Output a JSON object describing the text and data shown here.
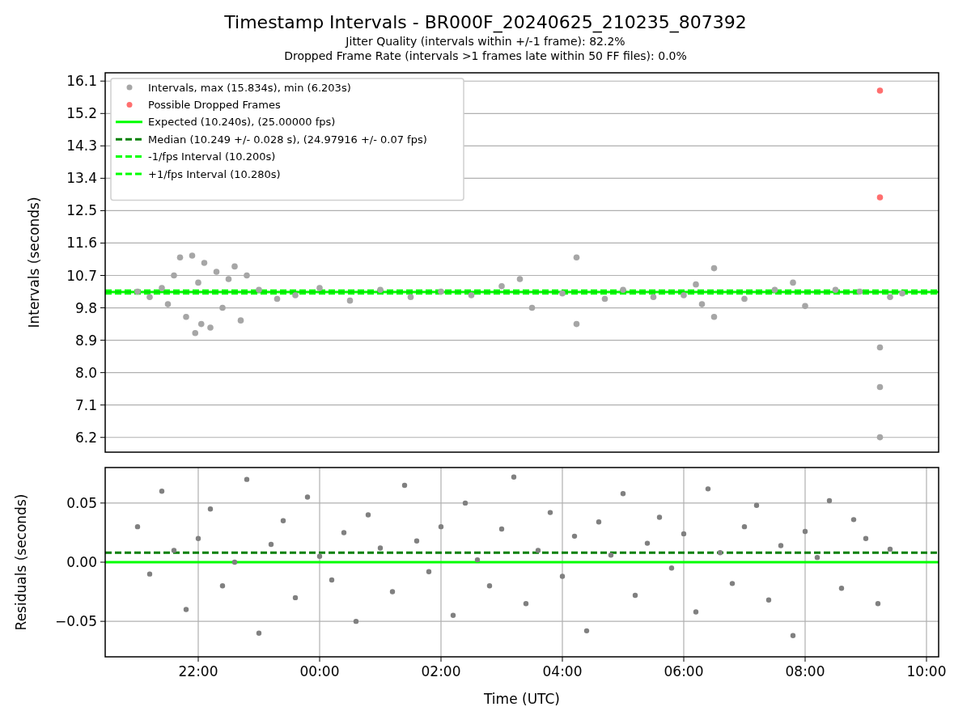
{
  "figure": {
    "title": "Timestamp Intervals - BR000F_20240625_210235_807392",
    "subtitles": [
      "Jitter Quality (intervals within +/-1 frame): 82.2%",
      "Dropped Frame Rate (intervals >1 frames late within 50 FF files): 0.0%"
    ]
  },
  "intervals_plot": {
    "chart_data": {
      "type": "scatter",
      "ylabel": "Intervals (seconds)",
      "grid": true,
      "legend": true,
      "xlim": [
        "2024-06-25T20:28",
        "2024-06-26T10:12"
      ],
      "ylim": [
        5.79,
        16.33
      ],
      "yticks": [
        {
          "value": 6.2,
          "label": "6.2"
        },
        {
          "value": 7.1,
          "label": "7.1"
        },
        {
          "value": 8.0,
          "label": "8.0"
        },
        {
          "value": 8.9,
          "label": "8.9"
        },
        {
          "value": 9.8,
          "label": "9.8"
        },
        {
          "value": 10.7,
          "label": "10.7"
        },
        {
          "value": 11.6,
          "label": "11.6"
        },
        {
          "value": 12.5,
          "label": "12.5"
        },
        {
          "value": 13.4,
          "label": "13.4"
        },
        {
          "value": 14.3,
          "label": "14.3"
        },
        {
          "value": 15.2,
          "label": "15.2"
        },
        {
          "value": 16.1,
          "label": "16.1"
        }
      ],
      "series": [
        {
          "name": "Intervals, max (15.834s), min (6.203s)",
          "color": "#a6a6a6",
          "x": [
            "2024-06-25T21:00",
            "2024-06-25T21:12",
            "2024-06-25T21:24",
            "2024-06-25T21:30",
            "2024-06-25T21:36",
            "2024-06-25T21:42",
            "2024-06-25T21:48",
            "2024-06-25T21:54",
            "2024-06-25T21:57",
            "2024-06-25T22:00",
            "2024-06-25T22:03",
            "2024-06-25T22:06",
            "2024-06-25T22:12",
            "2024-06-25T22:18",
            "2024-06-25T22:24",
            "2024-06-25T22:30",
            "2024-06-25T22:36",
            "2024-06-25T22:42",
            "2024-06-25T22:48",
            "2024-06-25T23:00",
            "2024-06-25T23:18",
            "2024-06-25T23:36",
            "2024-06-26T00:00",
            "2024-06-26T00:30",
            "2024-06-26T01:00",
            "2024-06-26T01:30",
            "2024-06-26T02:00",
            "2024-06-26T02:30",
            "2024-06-26T03:00",
            "2024-06-26T03:18",
            "2024-06-26T03:30",
            "2024-06-26T04:00",
            "2024-06-26T04:14",
            "2024-06-26T04:14",
            "2024-06-26T04:42",
            "2024-06-26T05:00",
            "2024-06-26T05:30",
            "2024-06-26T06:00",
            "2024-06-26T06:12",
            "2024-06-26T06:18",
            "2024-06-26T06:30",
            "2024-06-26T06:30",
            "2024-06-26T07:00",
            "2024-06-26T07:30",
            "2024-06-26T07:48",
            "2024-06-26T08:00",
            "2024-06-26T08:30",
            "2024-06-26T08:54",
            "2024-06-26T09:14",
            "2024-06-26T09:14",
            "2024-06-26T09:14",
            "2024-06-26T09:24",
            "2024-06-26T09:36"
          ],
          "values": [
            10.25,
            10.1,
            10.35,
            9.9,
            10.7,
            11.2,
            9.55,
            11.25,
            9.1,
            10.5,
            9.35,
            11.05,
            9.25,
            10.8,
            9.8,
            10.6,
            10.95,
            9.45,
            10.7,
            10.3,
            10.05,
            10.15,
            10.35,
            10.0,
            10.3,
            10.1,
            10.25,
            10.15,
            10.4,
            10.6,
            9.8,
            10.2,
            11.2,
            9.35,
            10.05,
            10.3,
            10.1,
            10.15,
            10.45,
            9.9,
            10.9,
            9.55,
            10.05,
            10.3,
            10.5,
            9.85,
            10.3,
            10.25,
            8.7,
            7.6,
            6.203,
            10.1,
            10.2
          ]
        },
        {
          "name": "Possible Dropped Frames",
          "color": "#ff6f6f",
          "x": [
            "2024-06-26T09:14",
            "2024-06-26T09:14"
          ],
          "values": [
            15.834,
            12.87
          ]
        }
      ],
      "ref_lines": [
        {
          "axis": "y",
          "value": 10.24,
          "label": "Expected (10.240s), (25.00000 fps)"
        },
        {
          "axis": "y",
          "value": 10.249,
          "label": "Median (10.249 +/- 0.028 s), (24.97916 +/- 0.07 fps)"
        },
        {
          "axis": "y",
          "value": 10.2,
          "label": "-1/fps Interval (10.200s)"
        },
        {
          "axis": "y",
          "value": 10.28,
          "label": "+1/fps Interval (10.280s)"
        }
      ]
    }
  },
  "residuals_plot": {
    "chart_data": {
      "type": "scatter",
      "xlabel": "Time (UTC)",
      "ylabel": "Residuals (seconds)",
      "grid": true,
      "xlim": [
        "2024-06-25T20:28",
        "2024-06-26T10:12"
      ],
      "ylim": [
        -0.08,
        0.08
      ],
      "xticks": [
        {
          "value": "2024-06-25T22:00",
          "label": "22:00"
        },
        {
          "value": "2024-06-26T00:00",
          "label": "00:00"
        },
        {
          "value": "2024-06-26T02:00",
          "label": "02:00"
        },
        {
          "value": "2024-06-26T04:00",
          "label": "04:00"
        },
        {
          "value": "2024-06-26T06:00",
          "label": "06:00"
        },
        {
          "value": "2024-06-26T08:00",
          "label": "08:00"
        },
        {
          "value": "2024-06-26T10:00",
          "label": "10:00"
        }
      ],
      "yticks": [
        {
          "value": -0.05,
          "label": "−0.05"
        },
        {
          "value": 0,
          "label": "0.00"
        },
        {
          "value": 0.05,
          "label": "0.05"
        }
      ],
      "series": [
        {
          "color": "#808080",
          "x": [
            "2024-06-25T21:00",
            "2024-06-25T21:12",
            "2024-06-25T21:24",
            "2024-06-25T21:36",
            "2024-06-25T21:48",
            "2024-06-25T22:00",
            "2024-06-25T22:12",
            "2024-06-25T22:24",
            "2024-06-25T22:36",
            "2024-06-25T22:48",
            "2024-06-25T23:00",
            "2024-06-25T23:12",
            "2024-06-25T23:24",
            "2024-06-25T23:36",
            "2024-06-25T23:48",
            "2024-06-26T00:00",
            "2024-06-26T00:12",
            "2024-06-26T00:24",
            "2024-06-26T00:36",
            "2024-06-26T00:48",
            "2024-06-26T01:00",
            "2024-06-26T01:12",
            "2024-06-26T01:24",
            "2024-06-26T01:36",
            "2024-06-26T01:48",
            "2024-06-26T02:00",
            "2024-06-26T02:12",
            "2024-06-26T02:24",
            "2024-06-26T02:36",
            "2024-06-26T02:48",
            "2024-06-26T03:00",
            "2024-06-26T03:12",
            "2024-06-26T03:24",
            "2024-06-26T03:36",
            "2024-06-26T03:48",
            "2024-06-26T04:00",
            "2024-06-26T04:12",
            "2024-06-26T04:24",
            "2024-06-26T04:36",
            "2024-06-26T04:48",
            "2024-06-26T05:00",
            "2024-06-26T05:12",
            "2024-06-26T05:24",
            "2024-06-26T05:36",
            "2024-06-26T05:48",
            "2024-06-26T06:00",
            "2024-06-26T06:12",
            "2024-06-26T06:24",
            "2024-06-26T06:36",
            "2024-06-26T06:48",
            "2024-06-26T07:00",
            "2024-06-26T07:12",
            "2024-06-26T07:24",
            "2024-06-26T07:36",
            "2024-06-26T07:48",
            "2024-06-26T08:00",
            "2024-06-26T08:12",
            "2024-06-26T08:24",
            "2024-06-26T08:36",
            "2024-06-26T08:48",
            "2024-06-26T09:00",
            "2024-06-26T09:12",
            "2024-06-26T09:24"
          ],
          "values": [
            0.03,
            -0.01,
            0.06,
            0.01,
            -0.04,
            0.02,
            0.045,
            -0.02,
            0.0,
            0.07,
            -0.06,
            0.015,
            0.035,
            -0.03,
            0.055,
            0.005,
            -0.015,
            0.025,
            -0.05,
            0.04,
            0.012,
            -0.025,
            0.065,
            0.018,
            -0.008,
            0.03,
            -0.045,
            0.05,
            0.002,
            -0.02,
            0.028,
            0.072,
            -0.035,
            0.01,
            0.042,
            -0.012,
            0.022,
            -0.058,
            0.034,
            0.006,
            0.058,
            -0.028,
            0.016,
            0.038,
            -0.005,
            0.024,
            -0.042,
            0.062,
            0.008,
            -0.018,
            0.03,
            0.048,
            -0.032,
            0.014,
            -0.062,
            0.026,
            0.004,
            0.052,
            -0.022,
            0.036,
            0.02,
            -0.035,
            0.011
          ]
        }
      ],
      "ref_lines": [
        {
          "axis": "y",
          "value": 0.0
        },
        {
          "axis": "y",
          "value": 0.008
        }
      ]
    }
  }
}
